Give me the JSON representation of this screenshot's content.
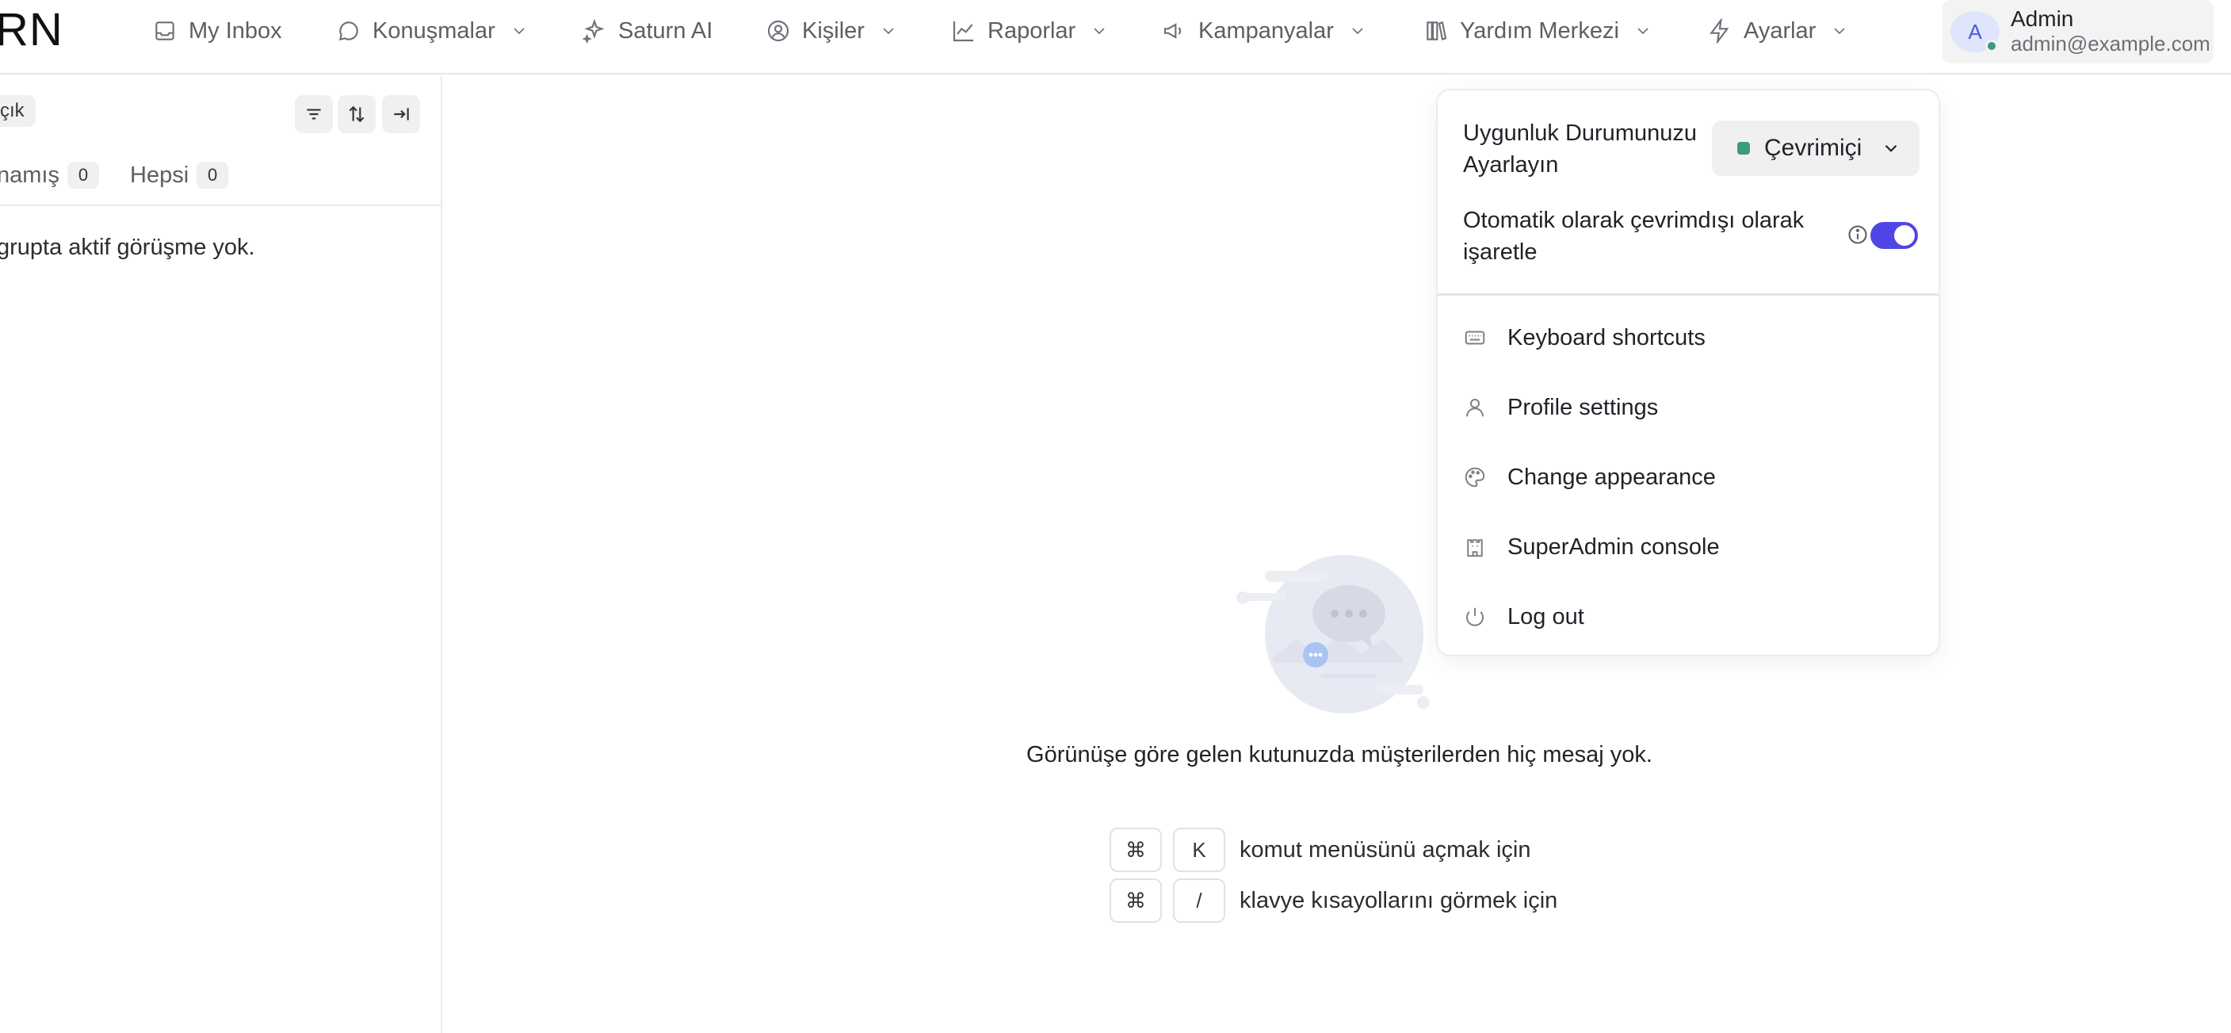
{
  "brand": {
    "logo_text": "RN"
  },
  "nav": {
    "items": [
      {
        "label": "My Inbox",
        "icon": "inbox-icon",
        "has_dropdown": false
      },
      {
        "label": "Konuşmalar",
        "icon": "chat-bubble-icon",
        "has_dropdown": true
      },
      {
        "label": "Saturn AI",
        "icon": "sparkles-icon",
        "has_dropdown": false
      },
      {
        "label": "Kişiler",
        "icon": "contact-icon",
        "has_dropdown": true
      },
      {
        "label": "Raporlar",
        "icon": "chart-line-icon",
        "has_dropdown": true
      },
      {
        "label": "Kampanyalar",
        "icon": "megaphone-icon",
        "has_dropdown": true
      },
      {
        "label": "Yardım Merkezi",
        "icon": "library-icon",
        "has_dropdown": true
      },
      {
        "label": "Ayarlar",
        "icon": "bolt-icon",
        "has_dropdown": true
      }
    ]
  },
  "user": {
    "initial": "A",
    "name": "Admin",
    "email": "admin@example.com",
    "presence_color": "#3d9a7d"
  },
  "conversation_list": {
    "status_filter": "çık",
    "tabs": [
      {
        "label": "namış",
        "count": "0"
      },
      {
        "label": "Hepsi",
        "count": "0"
      }
    ],
    "empty_message": "grupta aktif görüşme yok.",
    "toolbar_icons": [
      "filter-icon",
      "sort-icon",
      "collapse-panel-icon"
    ]
  },
  "main": {
    "empty_message": "Görünüşe göre gelen kutunuzda müşterilerden hiç mesaj yok.",
    "shortcuts": [
      {
        "keys": [
          "⌘",
          "K"
        ],
        "description": "komut menüsünü açmak için"
      },
      {
        "keys": [
          "⌘",
          "/"
        ],
        "description": "klavye kısayollarını görmek için"
      }
    ]
  },
  "profile_menu": {
    "availability_label_line1": "Uygunluk Durumunuzu",
    "availability_label_line2": "Ayarlayın",
    "availability_value": "Çevrimiçi",
    "availability_color": "#3d9a7d",
    "auto_offline_label_line1": "Otomatik olarak çevrimdışı olarak",
    "auto_offline_label_line2": "işaretle",
    "auto_offline_enabled": true,
    "toggle_color": "#4f46e5",
    "items": [
      {
        "label": "Keyboard shortcuts",
        "icon": "keyboard-icon"
      },
      {
        "label": "Profile settings",
        "icon": "user-icon"
      },
      {
        "label": "Change appearance",
        "icon": "palette-icon"
      },
      {
        "label": "SuperAdmin console",
        "icon": "castle-icon"
      },
      {
        "label": "Log out",
        "icon": "power-icon"
      }
    ]
  }
}
